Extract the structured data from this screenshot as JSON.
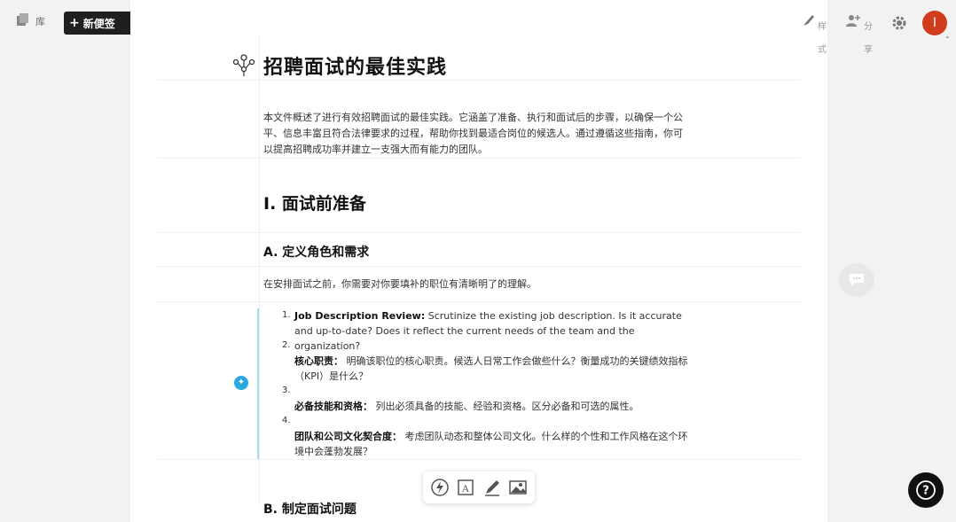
{
  "topbar": {
    "library_label": "库",
    "new_note_label": "新便签",
    "style_label": "样式",
    "share_label": "分享",
    "avatar_initial": "I"
  },
  "document": {
    "title": "招聘面试的最佳实践",
    "intro": "本文件概述了进行有效招聘面试的最佳实践。它涵盖了准备、执行和面试后的步骤，以确保一个公平、信息丰富且符合法律要求的过程，帮助你找到最适合岗位的候选人。通过遵循这些指南，你可以提高招聘成功率并建立一支强大而有能力的团队。",
    "section1_heading": "I. 面试前准备",
    "sub_a_heading": "A. 定义角色和需求",
    "sub_a_intro": "在安排面试之前，你需要对你要填补的职位有清晰明了的理解。",
    "list": [
      {
        "number": "1.",
        "bold": "Job Description Review:",
        "text": " Scrutinize the existing job description. Is it accurate and up-to-date? Does it reflect the current needs of the team and the organization?"
      },
      {
        "number": "2.",
        "bold": "核心职责：",
        "text": " 明确该职位的核心职责。候选人日常工作会做些什么？衡量成功的关键绩效指标（KPI）是什么？"
      },
      {
        "number": "3.",
        "bold": "必备技能和资格：",
        "text": " 列出必须具备的技能、经验和资格。区分必备和可选的属性。"
      },
      {
        "number": "4.",
        "bold": "团队和公司文化契合度：",
        "text": " 考虑团队动态和整体公司文化。什么样的个性和工作风格在这个环境中会蓬勃发展？"
      }
    ],
    "sub_b_heading": "B. 制定面试问题"
  },
  "colors": {
    "accent_blue": "#29a7df",
    "avatar_red": "#d13c1d",
    "dark": "#1f1f1f"
  }
}
